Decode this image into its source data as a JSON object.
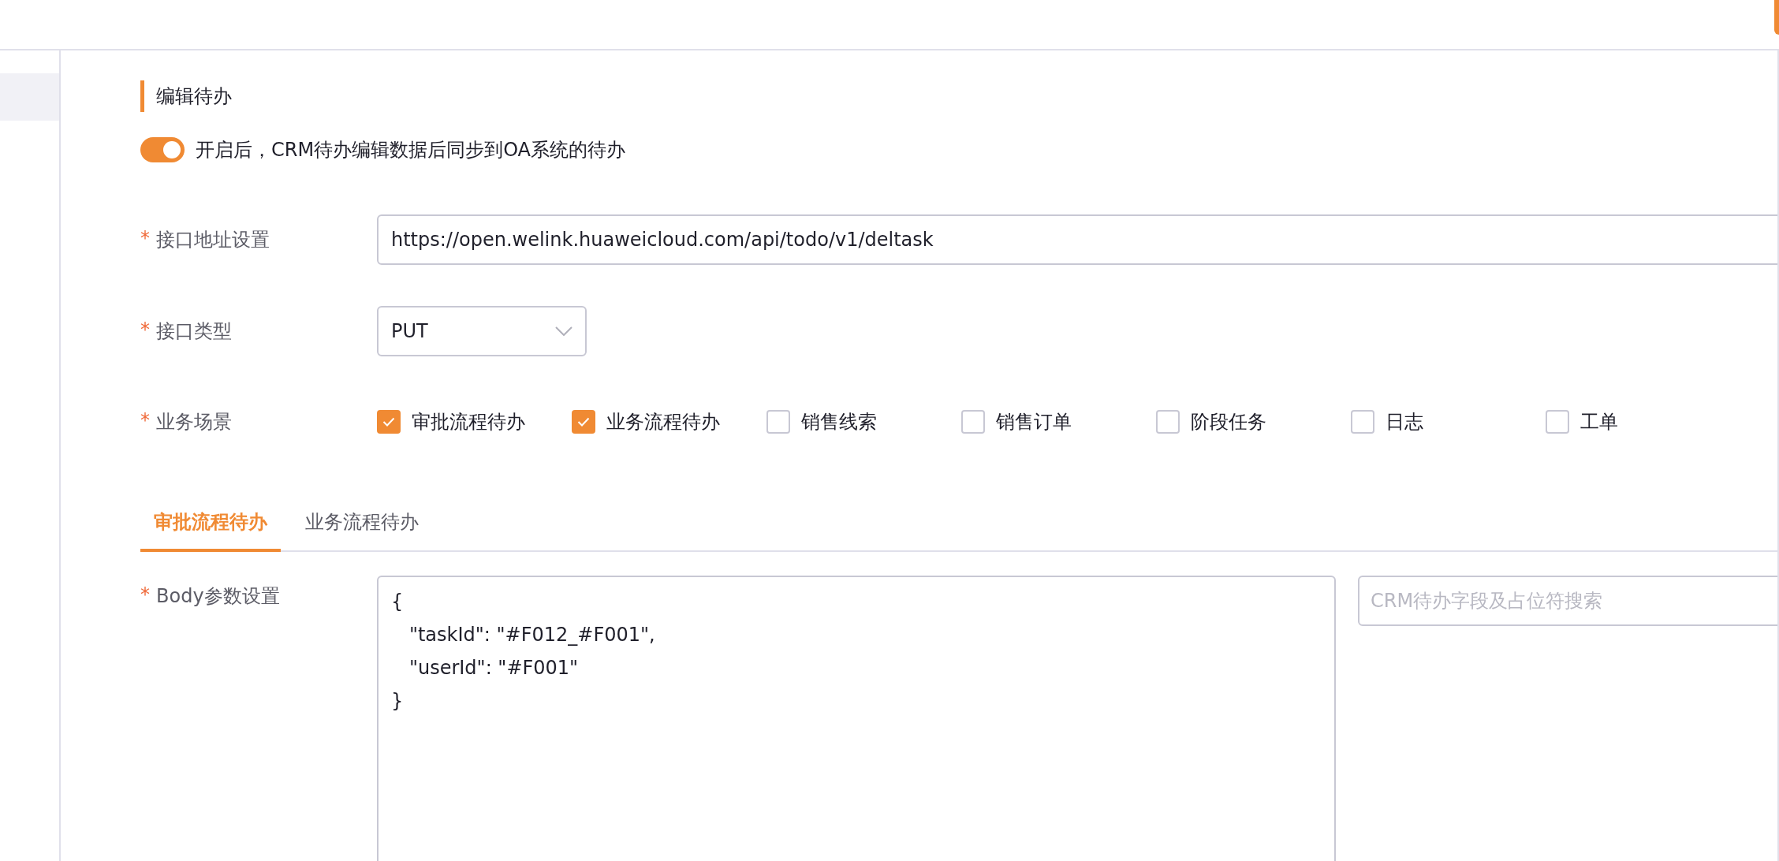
{
  "section_title": "编辑待办",
  "sync_toggle": {
    "on": true,
    "label": "开启后，CRM待办编辑数据后同步到OA系统的待办"
  },
  "fields": [
    {
      "kind": "input",
      "label": "接口地址设置",
      "required_mark": "*",
      "value": "https://open.welink.huaweicloud.com/api/todo/v1/deltask"
    },
    {
      "kind": "select",
      "label": "接口类型",
      "required_mark": "*",
      "value": "PUT"
    }
  ],
  "scenarios": {
    "label": "业务场景",
    "required_mark": "*",
    "options": [
      {
        "label": "审批流程待办",
        "checked": true
      },
      {
        "label": "业务流程待办",
        "checked": true
      },
      {
        "label": "销售线索",
        "checked": false
      },
      {
        "label": "销售订单",
        "checked": false
      },
      {
        "label": "阶段任务",
        "checked": false
      },
      {
        "label": "日志",
        "checked": false
      },
      {
        "label": "工单",
        "checked": false
      }
    ]
  },
  "tabs": [
    {
      "label": "审批流程待办",
      "selected": true
    },
    {
      "label": "业务流程待办",
      "selected": false
    }
  ],
  "body": {
    "label": "Body参数设置",
    "required_mark": "*",
    "value": "{\n   \"taskId\": \"#F012_#F001\",\n   \"userId\": \"#F001\"\n}",
    "search_placeholder": "CRM待办字段及占位符搜索"
  }
}
